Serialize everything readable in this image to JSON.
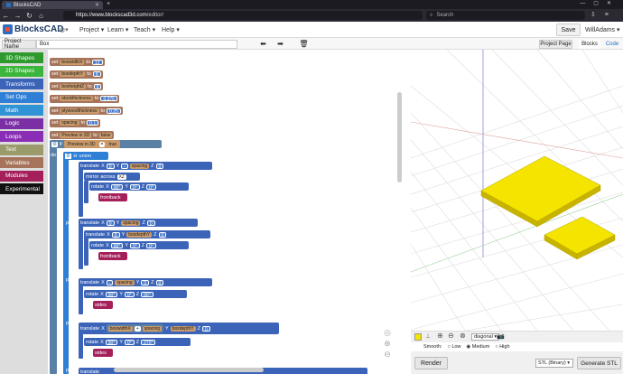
{
  "browser": {
    "tab_title": "BlocksCAD",
    "url_domain": "https://www.blockscad3d.com",
    "url_path": "/editor/",
    "search_placeholder": "Search"
  },
  "header": {
    "logo": "BlocksCAD",
    "menus": [
      "Project",
      "Learn",
      "Teach",
      "Help"
    ],
    "save": "Save",
    "user": "WillAdams"
  },
  "project": {
    "label": "Project Name",
    "name": "Box",
    "project_page": "Project Page",
    "tab_blocks": "Blocks",
    "tab_code": "Code"
  },
  "toolbox": [
    {
      "label": "3D Shapes",
      "color": "#2e9a2e"
    },
    {
      "label": "2D Shapes",
      "color": "#3bb53b"
    },
    {
      "label": "Transforms",
      "color": "#3b64b8"
    },
    {
      "label": "Set Ops",
      "color": "#2f7fd6"
    },
    {
      "label": "Math",
      "color": "#2f93d6"
    },
    {
      "label": "Logic",
      "color": "#7a2fa5"
    },
    {
      "label": "Loops",
      "color": "#8a2fb5"
    },
    {
      "label": "Text",
      "color": "#9a9a6a"
    },
    {
      "label": "Variables",
      "color": "#a5745b"
    },
    {
      "label": "Modules",
      "color": "#a5205b"
    },
    {
      "label": "Experimental",
      "color": "#111111"
    }
  ],
  "blocks": {
    "set_word": "set",
    "to_word": "to",
    "sets": [
      {
        "var": "boxwidthX",
        "val": "12"
      },
      {
        "var": "boxdepthY",
        "val": "8"
      },
      {
        "var": "boxheightZ",
        "val": "6"
      },
      {
        "var": "stockthickness",
        "val": "0.375"
      },
      {
        "var": "plywoodthickness",
        "val": "0.25"
      },
      {
        "var": "spacing",
        "val": "0.1"
      },
      {
        "var": "Preview in 3D",
        "val": "false"
      }
    ],
    "if_word": "if",
    "do_word": "do",
    "cond_var": "Preview in 3D",
    "cond_op": "=",
    "cond_val": "true",
    "union": "union",
    "plus": "plus",
    "translate": "translate",
    "mirror": "mirror",
    "across": "across",
    "plane": "XZ",
    "rotate": "rotate",
    "spacing": "spacing",
    "boxdepthY": "boxdepthY",
    "boxwidthX": "boxwidthX",
    "frontback": "frontback",
    "sides": "sides",
    "zero": "0",
    "d90": "90°",
    "d0": "0°",
    "d270": "270°",
    "minus": "-",
    "plus_op": "+",
    "axis_x": "X",
    "axis_y": "Y",
    "axis_z": "Z"
  },
  "viewer": {
    "view": "diagonal",
    "smooth": "Smooth:",
    "low": "Low",
    "medium": "Medium",
    "high": "High",
    "render": "Render",
    "stl_format": "STL (Binary)",
    "generate": "Generate STL",
    "model_color": "#f4e400"
  }
}
